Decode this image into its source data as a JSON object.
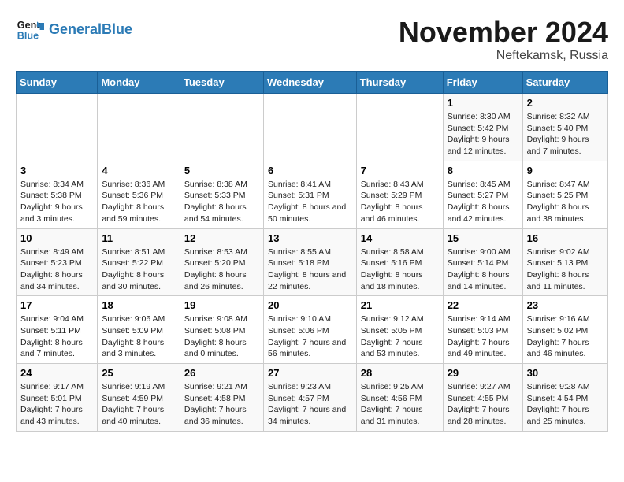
{
  "logo": {
    "line1": "General",
    "line2": "Blue"
  },
  "header": {
    "month": "November 2024",
    "location": "Neftekamsk, Russia"
  },
  "weekdays": [
    "Sunday",
    "Monday",
    "Tuesday",
    "Wednesday",
    "Thursday",
    "Friday",
    "Saturday"
  ],
  "weeks": [
    [
      {
        "day": "",
        "info": ""
      },
      {
        "day": "",
        "info": ""
      },
      {
        "day": "",
        "info": ""
      },
      {
        "day": "",
        "info": ""
      },
      {
        "day": "",
        "info": ""
      },
      {
        "day": "1",
        "info": "Sunrise: 8:30 AM\nSunset: 5:42 PM\nDaylight: 9 hours and 12 minutes."
      },
      {
        "day": "2",
        "info": "Sunrise: 8:32 AM\nSunset: 5:40 PM\nDaylight: 9 hours and 7 minutes."
      }
    ],
    [
      {
        "day": "3",
        "info": "Sunrise: 8:34 AM\nSunset: 5:38 PM\nDaylight: 9 hours and 3 minutes."
      },
      {
        "day": "4",
        "info": "Sunrise: 8:36 AM\nSunset: 5:36 PM\nDaylight: 8 hours and 59 minutes."
      },
      {
        "day": "5",
        "info": "Sunrise: 8:38 AM\nSunset: 5:33 PM\nDaylight: 8 hours and 54 minutes."
      },
      {
        "day": "6",
        "info": "Sunrise: 8:41 AM\nSunset: 5:31 PM\nDaylight: 8 hours and 50 minutes."
      },
      {
        "day": "7",
        "info": "Sunrise: 8:43 AM\nSunset: 5:29 PM\nDaylight: 8 hours and 46 minutes."
      },
      {
        "day": "8",
        "info": "Sunrise: 8:45 AM\nSunset: 5:27 PM\nDaylight: 8 hours and 42 minutes."
      },
      {
        "day": "9",
        "info": "Sunrise: 8:47 AM\nSunset: 5:25 PM\nDaylight: 8 hours and 38 minutes."
      }
    ],
    [
      {
        "day": "10",
        "info": "Sunrise: 8:49 AM\nSunset: 5:23 PM\nDaylight: 8 hours and 34 minutes."
      },
      {
        "day": "11",
        "info": "Sunrise: 8:51 AM\nSunset: 5:22 PM\nDaylight: 8 hours and 30 minutes."
      },
      {
        "day": "12",
        "info": "Sunrise: 8:53 AM\nSunset: 5:20 PM\nDaylight: 8 hours and 26 minutes."
      },
      {
        "day": "13",
        "info": "Sunrise: 8:55 AM\nSunset: 5:18 PM\nDaylight: 8 hours and 22 minutes."
      },
      {
        "day": "14",
        "info": "Sunrise: 8:58 AM\nSunset: 5:16 PM\nDaylight: 8 hours and 18 minutes."
      },
      {
        "day": "15",
        "info": "Sunrise: 9:00 AM\nSunset: 5:14 PM\nDaylight: 8 hours and 14 minutes."
      },
      {
        "day": "16",
        "info": "Sunrise: 9:02 AM\nSunset: 5:13 PM\nDaylight: 8 hours and 11 minutes."
      }
    ],
    [
      {
        "day": "17",
        "info": "Sunrise: 9:04 AM\nSunset: 5:11 PM\nDaylight: 8 hours and 7 minutes."
      },
      {
        "day": "18",
        "info": "Sunrise: 9:06 AM\nSunset: 5:09 PM\nDaylight: 8 hours and 3 minutes."
      },
      {
        "day": "19",
        "info": "Sunrise: 9:08 AM\nSunset: 5:08 PM\nDaylight: 8 hours and 0 minutes."
      },
      {
        "day": "20",
        "info": "Sunrise: 9:10 AM\nSunset: 5:06 PM\nDaylight: 7 hours and 56 minutes."
      },
      {
        "day": "21",
        "info": "Sunrise: 9:12 AM\nSunset: 5:05 PM\nDaylight: 7 hours and 53 minutes."
      },
      {
        "day": "22",
        "info": "Sunrise: 9:14 AM\nSunset: 5:03 PM\nDaylight: 7 hours and 49 minutes."
      },
      {
        "day": "23",
        "info": "Sunrise: 9:16 AM\nSunset: 5:02 PM\nDaylight: 7 hours and 46 minutes."
      }
    ],
    [
      {
        "day": "24",
        "info": "Sunrise: 9:17 AM\nSunset: 5:01 PM\nDaylight: 7 hours and 43 minutes."
      },
      {
        "day": "25",
        "info": "Sunrise: 9:19 AM\nSunset: 4:59 PM\nDaylight: 7 hours and 40 minutes."
      },
      {
        "day": "26",
        "info": "Sunrise: 9:21 AM\nSunset: 4:58 PM\nDaylight: 7 hours and 36 minutes."
      },
      {
        "day": "27",
        "info": "Sunrise: 9:23 AM\nSunset: 4:57 PM\nDaylight: 7 hours and 34 minutes."
      },
      {
        "day": "28",
        "info": "Sunrise: 9:25 AM\nSunset: 4:56 PM\nDaylight: 7 hours and 31 minutes."
      },
      {
        "day": "29",
        "info": "Sunrise: 9:27 AM\nSunset: 4:55 PM\nDaylight: 7 hours and 28 minutes."
      },
      {
        "day": "30",
        "info": "Sunrise: 9:28 AM\nSunset: 4:54 PM\nDaylight: 7 hours and 25 minutes."
      }
    ]
  ]
}
